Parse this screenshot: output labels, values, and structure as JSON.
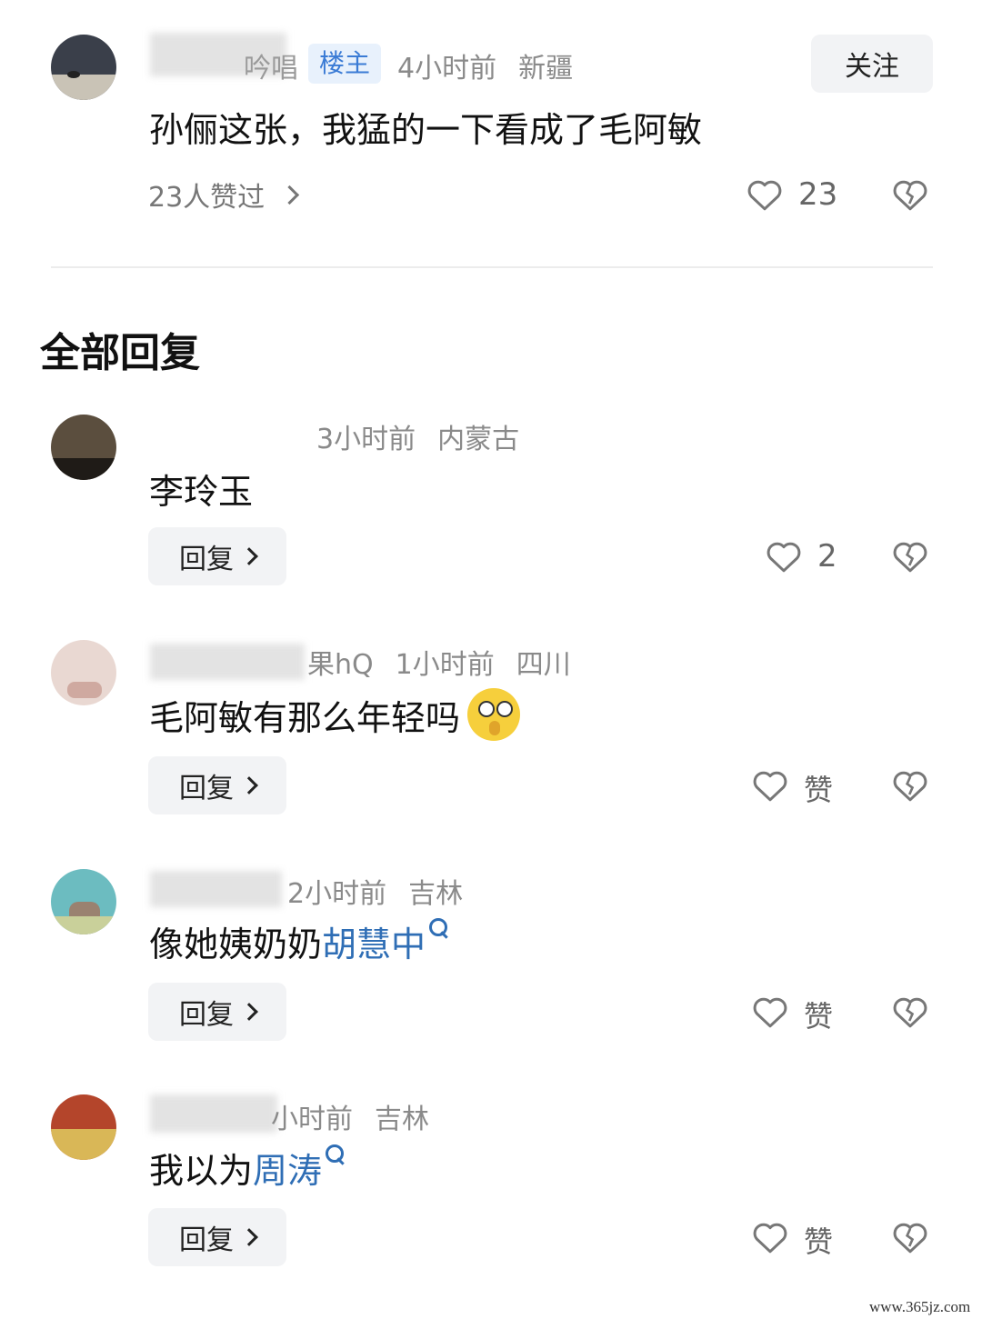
{
  "main_comment": {
    "username_visible": "吟唱",
    "owner_badge": "楼主",
    "time": "4小时前",
    "location": "新疆",
    "follow_label": "关注",
    "text": "孙俪这张，我猛的一下看成了毛阿敏",
    "likers": "23人赞过",
    "like_count": "23"
  },
  "section_title": "全部回复",
  "replies": [
    {
      "username_visible": "",
      "time": "3小时前",
      "location": "内蒙古",
      "text": "李玲玉",
      "reply_label": "回复",
      "like_label": "2"
    },
    {
      "username_visible": "果hQ",
      "time": "1小时前",
      "location": "四川",
      "text": "毛阿敏有那么年轻吗",
      "reply_label": "回复",
      "like_label": "赞"
    },
    {
      "username_visible": "",
      "time": "2小时前",
      "location": "吉林",
      "text_prefix": "像她姨奶奶",
      "link_text": "胡慧中",
      "reply_label": "回复",
      "like_label": "赞"
    },
    {
      "username_visible": "",
      "time": "小时前",
      "location": "吉林",
      "text_prefix": "我以为",
      "link_text": "周涛",
      "reply_label": "回复",
      "like_label": "赞"
    }
  ],
  "watermark": "www.365jz.com",
  "colors": {
    "link": "#2f6eb5",
    "badge_bg": "#e8f1fc",
    "badge_text": "#3a7bd5",
    "button_bg": "#f2f3f5"
  }
}
